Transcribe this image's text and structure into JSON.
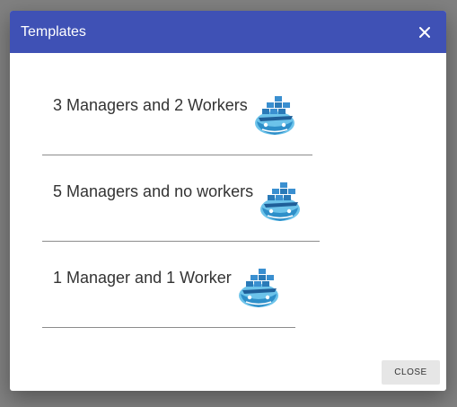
{
  "dialog": {
    "title": "Templates",
    "close_icon": "close-icon",
    "close_button_label": "CLOSE"
  },
  "templates": [
    {
      "label": "3 Managers and 2 Workers",
      "icon": "docker-whale-icon"
    },
    {
      "label": "5 Managers and no workers",
      "icon": "docker-whale-icon"
    },
    {
      "label": "1 Manager and 1 Worker",
      "icon": "docker-whale-icon"
    }
  ],
  "colors": {
    "header": "#3f51b5",
    "overlay": "#808080"
  }
}
